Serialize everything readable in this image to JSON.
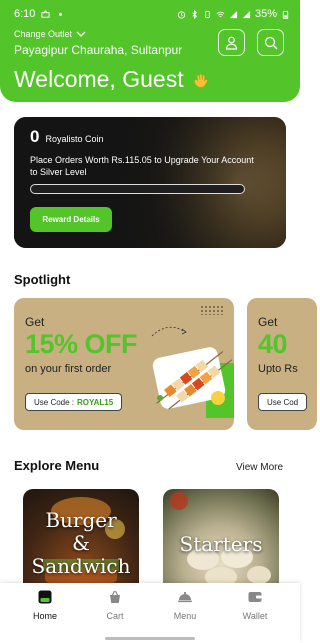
{
  "status_bar": {
    "time": "6:10",
    "battery": "35%"
  },
  "header": {
    "change_outlet_label": "Change Outlet",
    "outlet_name": "Payagipur Chauraha, Sultanpur",
    "welcome_text": "Welcome, Guest",
    "accent_color": "#53c42a"
  },
  "reward": {
    "coin_count": "0",
    "coin_label": "Royalisto Coin",
    "message": "Place Orders Worth Rs.115.05 to Upgrade Your Account to Silver Level",
    "progress_fraction": 0,
    "button_label": "Reward Details"
  },
  "spotlight": {
    "title": "Spotlight",
    "offers": [
      {
        "get": "Get",
        "percent": "15% OFF",
        "subtitle": "on your first order",
        "code_label": "Use Code :",
        "code": "ROYAL15"
      },
      {
        "get": "Get",
        "percent": "40",
        "subtitle": "Upto Rs",
        "code_label": "Use Cod",
        "code": ""
      }
    ]
  },
  "explore": {
    "title": "Explore Menu",
    "view_more": "View More",
    "categories": [
      {
        "label_line1": "Burger",
        "label_line2": "&",
        "label_line3": "Sandwich"
      },
      {
        "label_line1": "Starters"
      }
    ]
  },
  "bottom_nav": {
    "items": [
      {
        "label": "Home",
        "icon": "home-icon",
        "active": true
      },
      {
        "label": "Cart",
        "icon": "cart-icon",
        "active": false
      },
      {
        "label": "Menu",
        "icon": "cloche-icon",
        "active": false
      },
      {
        "label": "Wallet",
        "icon": "wallet-icon",
        "active": false
      }
    ]
  }
}
